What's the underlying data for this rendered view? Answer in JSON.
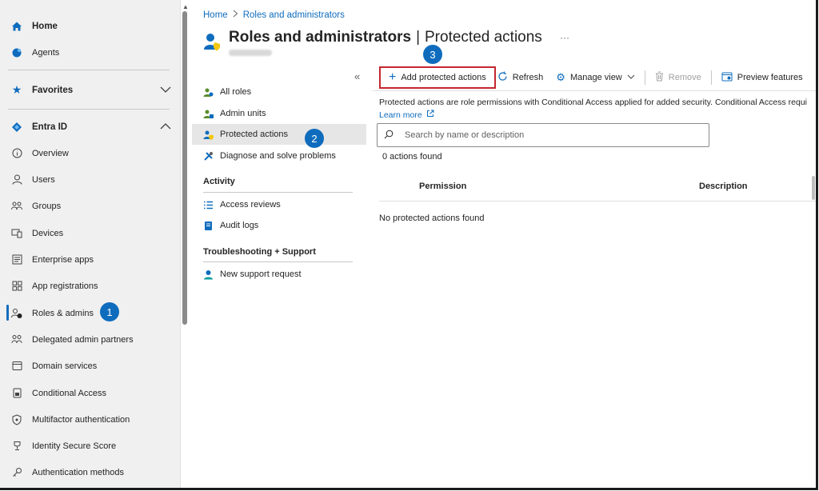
{
  "leftnav": {
    "home": "Home",
    "agents": "Agents",
    "favorites": "Favorites",
    "entra_id": "Entra ID",
    "items": [
      {
        "label": "Overview",
        "icon": "info-icon"
      },
      {
        "label": "Users",
        "icon": "user-icon"
      },
      {
        "label": "Groups",
        "icon": "groups-icon"
      },
      {
        "label": "Devices",
        "icon": "devices-icon"
      },
      {
        "label": "Enterprise apps",
        "icon": "enterprise-apps-icon"
      },
      {
        "label": "App registrations",
        "icon": "app-registrations-icon"
      },
      {
        "label": "Roles & admins",
        "icon": "roles-icon"
      },
      {
        "label": "Delegated admin partners",
        "icon": "partners-icon"
      },
      {
        "label": "Domain services",
        "icon": "domain-icon"
      },
      {
        "label": "Conditional Access",
        "icon": "conditional-access-icon"
      },
      {
        "label": "Multifactor authentication",
        "icon": "shield-icon"
      },
      {
        "label": "Identity Secure Score",
        "icon": "trophy-icon"
      },
      {
        "label": "Authentication methods",
        "icon": "key-icon"
      }
    ]
  },
  "badges": {
    "one": "1",
    "two": "2",
    "three": "3"
  },
  "breadcrumb": {
    "home": "Home",
    "current": "Roles and administrators"
  },
  "header": {
    "title": "Roles and administrators",
    "separator": "|",
    "subtitle": "Protected actions",
    "more": "···"
  },
  "subnav": {
    "collapse": "«",
    "items": [
      "All roles",
      "Admin units",
      "Protected actions",
      "Diagnose and solve problems"
    ],
    "activity_heading": "Activity",
    "activity_items": [
      "Access reviews",
      "Audit logs"
    ],
    "support_heading": "Troubleshooting + Support",
    "support_items": [
      "New support request"
    ]
  },
  "toolbar": {
    "add": "Add protected actions",
    "refresh": "Refresh",
    "manage_view": "Manage view",
    "remove": "Remove",
    "preview": "Preview features"
  },
  "content": {
    "description": "Protected actions are role permissions with Conditional Access applied for added security. Conditional Access requi",
    "learn_more": "Learn more",
    "search_placeholder": "Search by name or description",
    "found": "0 actions found",
    "col_permission": "Permission",
    "col_description": "Description",
    "empty": "No protected actions found"
  },
  "colors": {
    "accent": "#0f6cbd",
    "highlight": "#c4262e"
  }
}
